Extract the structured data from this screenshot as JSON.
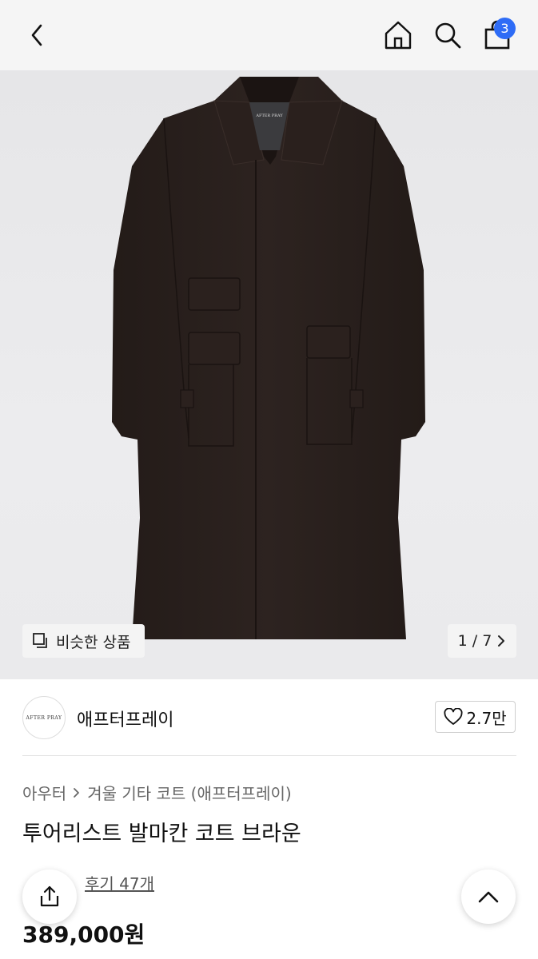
{
  "header": {
    "cart_count": "3"
  },
  "gallery": {
    "similar_label": "비슷한 상품",
    "pager_text": "1 / 7",
    "logo_text": "AFTER PRAY"
  },
  "brand": {
    "logo_text": "AFTER PRAY",
    "name": "애프터프레이",
    "likes": "2.7만"
  },
  "product": {
    "category_parent": "아우터",
    "category_child": "겨울 기타 코트 (애프터프레이)",
    "title": "투어리스트 발마칸 코트 브라운",
    "review_label": "후기 47개",
    "price": "389,000원"
  },
  "colors": {
    "badge": "#2e6cf6",
    "star": "#f5b800",
    "coat": "#2b221f"
  },
  "icons": {
    "back": "chevron-left-icon",
    "home": "home-icon",
    "search": "search-icon",
    "cart": "shopping-bag-icon",
    "similar": "similar-items-icon",
    "heart": "heart-icon",
    "share": "share-icon",
    "top": "chevron-up-icon"
  }
}
